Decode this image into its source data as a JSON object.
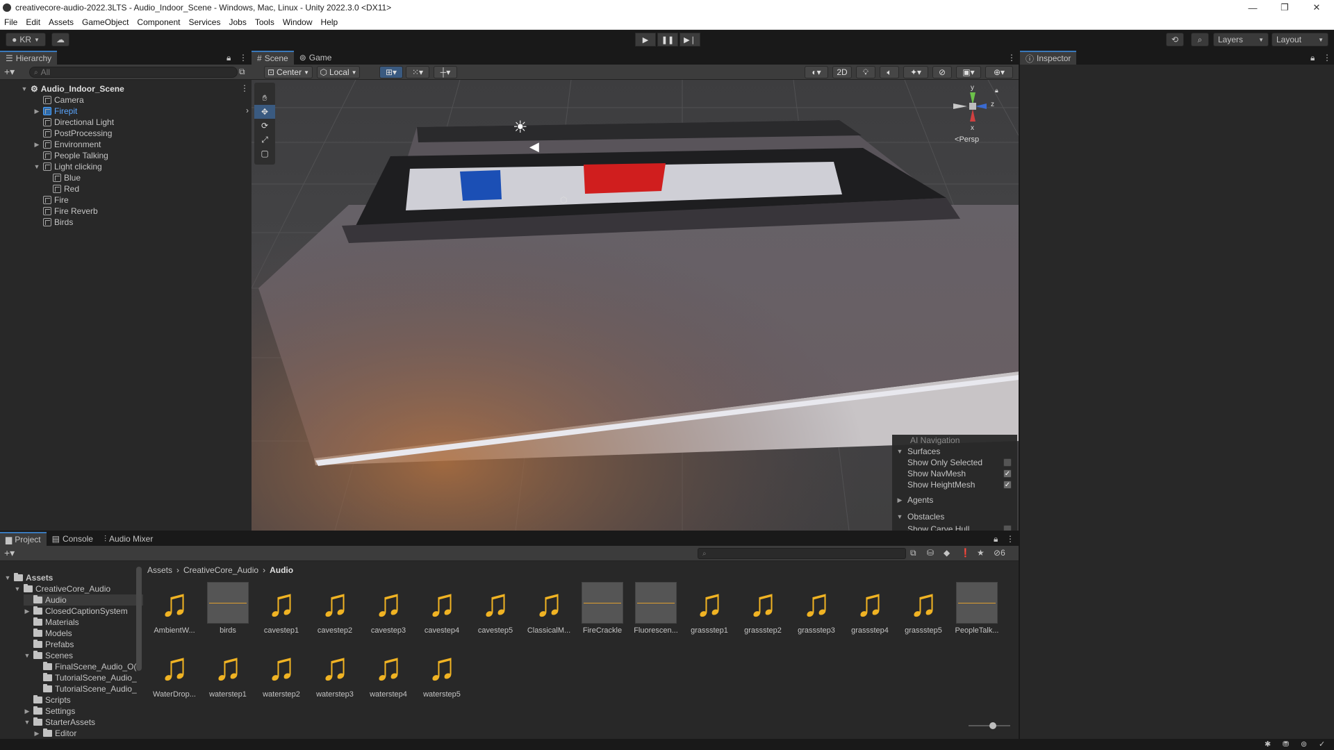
{
  "window": {
    "title": "creativecore-audio-2022.3LTS - Audio_Indoor_Scene - Windows, Mac, Linux - Unity 2022.3.0 <DX11>",
    "minimize": "—",
    "maximize": "❐",
    "close": "✕"
  },
  "menu": [
    "File",
    "Edit",
    "Assets",
    "GameObject",
    "Component",
    "Services",
    "Jobs",
    "Tools",
    "Window",
    "Help"
  ],
  "toolbar": {
    "account": "KR",
    "layers": "Layers",
    "layout": "Layout"
  },
  "hierarchy": {
    "tab": "Hierarchy",
    "search_placeholder": "All",
    "scene_name": "Audio_Indoor_Scene",
    "items": [
      {
        "label": "Camera",
        "depth": 1,
        "expander": ""
      },
      {
        "label": "Firepit",
        "depth": 1,
        "expander": "▶"
      },
      {
        "label": "Directional Light",
        "depth": 1,
        "expander": ""
      },
      {
        "label": "PostProcessing",
        "depth": 1,
        "expander": ""
      },
      {
        "label": "Environment",
        "depth": 1,
        "expander": "▶"
      },
      {
        "label": "People Talking",
        "depth": 1,
        "expander": ""
      },
      {
        "label": "Light clicking",
        "depth": 1,
        "expander": "▼"
      },
      {
        "label": "Blue",
        "depth": 2,
        "expander": ""
      },
      {
        "label": "Red",
        "depth": 2,
        "expander": ""
      },
      {
        "label": "Fire",
        "depth": 1,
        "expander": ""
      },
      {
        "label": "Fire Reverb",
        "depth": 1,
        "expander": ""
      },
      {
        "label": "Birds",
        "depth": 1,
        "expander": ""
      }
    ]
  },
  "scene": {
    "tabs": [
      "Scene",
      "Game"
    ],
    "pivot": "Center",
    "space": "Local",
    "mode_2d": "2D",
    "gizmo_label": "Persp",
    "axes": {
      "y": "y",
      "z": "z",
      "x": "x"
    }
  },
  "ai_navigation": {
    "title": "AI Navigation",
    "surfaces": "Surfaces",
    "show_only_selected": "Show Only Selected",
    "show_navmesh": "Show NavMesh",
    "show_heightmesh": "Show HeightMesh",
    "agents": "Agents",
    "obstacles": "Obstacles",
    "show_carve_hull": "Show Carve Hull",
    "checks": {
      "show_only_selected": false,
      "show_navmesh": true,
      "show_heightmesh": true,
      "show_carve_hull": false
    }
  },
  "inspector": {
    "tab": "Inspector"
  },
  "project": {
    "tabs": [
      "Project",
      "Console",
      "Audio Mixer"
    ],
    "hidden_count": "6",
    "breadcrumb": [
      "Assets",
      "CreativeCore_Audio",
      "Audio"
    ],
    "tree": [
      {
        "label": "Assets",
        "indent": 0,
        "expander": "▼",
        "bold": true
      },
      {
        "label": "CreativeCore_Audio",
        "indent": 1,
        "expander": "▼"
      },
      {
        "label": "Audio",
        "indent": 2,
        "expander": "",
        "selected": true
      },
      {
        "label": "ClosedCaptionSystem",
        "indent": 2,
        "expander": "▶"
      },
      {
        "label": "Materials",
        "indent": 2,
        "expander": ""
      },
      {
        "label": "Models",
        "indent": 2,
        "expander": ""
      },
      {
        "label": "Prefabs",
        "indent": 2,
        "expander": ""
      },
      {
        "label": "Scenes",
        "indent": 2,
        "expander": "▼"
      },
      {
        "label": "FinalScene_Audio_O(",
        "indent": 3,
        "expander": ""
      },
      {
        "label": "TutorialScene_Audio_",
        "indent": 3,
        "expander": ""
      },
      {
        "label": "TutorialScene_Audio_",
        "indent": 3,
        "expander": ""
      },
      {
        "label": "Scripts",
        "indent": 2,
        "expander": ""
      },
      {
        "label": "Settings",
        "indent": 2,
        "expander": "▶"
      },
      {
        "label": "StarterAssets",
        "indent": 2,
        "expander": "▼"
      },
      {
        "label": "Editor",
        "indent": 3,
        "expander": "▶"
      }
    ],
    "assets": [
      {
        "label": "AmbientW...",
        "kind": "audio"
      },
      {
        "label": "birds",
        "kind": "wave"
      },
      {
        "label": "cavestep1",
        "kind": "audio"
      },
      {
        "label": "cavestep2",
        "kind": "audio"
      },
      {
        "label": "cavestep3",
        "kind": "audio"
      },
      {
        "label": "cavestep4",
        "kind": "audio"
      },
      {
        "label": "cavestep5",
        "kind": "audio"
      },
      {
        "label": "ClassicalM...",
        "kind": "audio"
      },
      {
        "label": "FireCrackle",
        "kind": "wave"
      },
      {
        "label": "Fluorescen...",
        "kind": "wave"
      },
      {
        "label": "grassstep1",
        "kind": "audio"
      },
      {
        "label": "grassstep2",
        "kind": "audio"
      },
      {
        "label": "grassstep3",
        "kind": "audio"
      },
      {
        "label": "grassstep4",
        "kind": "audio"
      },
      {
        "label": "grassstep5",
        "kind": "audio"
      },
      {
        "label": "PeopleTalk...",
        "kind": "wave"
      },
      {
        "label": "WaterDrop...",
        "kind": "audio"
      },
      {
        "label": "waterstep1",
        "kind": "audio"
      },
      {
        "label": "waterstep2",
        "kind": "audio"
      },
      {
        "label": "waterstep3",
        "kind": "audio"
      },
      {
        "label": "waterstep4",
        "kind": "audio"
      },
      {
        "label": "waterstep5",
        "kind": "audio"
      }
    ],
    "zoom_fraction": 0.6
  },
  "colors": {
    "accent": "#3a79bb",
    "audio_icon": "#f0b323",
    "red_panel": "#d01e1e",
    "blue_panel": "#1b4fb5"
  }
}
